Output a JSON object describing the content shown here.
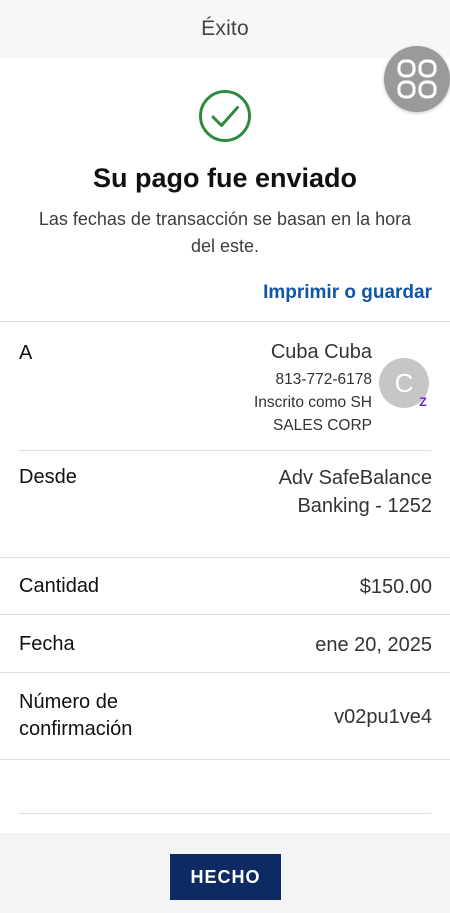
{
  "header": {
    "title": "Éxito"
  },
  "status": {
    "heading": "Su pago fue enviado",
    "subtext": "Las fechas de transacción se basan en la hora del este."
  },
  "actions": {
    "print_label": "Imprimir o guardar",
    "done_label": "HECHO"
  },
  "details": {
    "to": {
      "label": "A",
      "name": "Cuba Cuba",
      "phone": "813-772-6178",
      "enrolled_line1": "Inscrito como SH",
      "enrolled_line2": "SALES CORP",
      "avatar_initial": "C",
      "badge": "Z"
    },
    "from": {
      "label": "Desde",
      "line1": "Adv SafeBalance",
      "line2": "Banking - 1252"
    },
    "amount": {
      "label": "Cantidad",
      "value": "$150.00"
    },
    "date": {
      "label": "Fecha",
      "value": "ene 20, 2025"
    },
    "confirmation": {
      "label_line1": "Número de",
      "label_line2": "confirmación",
      "value": "v02pu1ve4"
    }
  },
  "icons": {
    "success": "check-circle-icon",
    "fab": "grid-icon",
    "badge": "zelle-icon"
  },
  "colors": {
    "accent_link": "#1255a3",
    "success_green": "#2e8b3d",
    "button_navy": "#0e2a63"
  }
}
